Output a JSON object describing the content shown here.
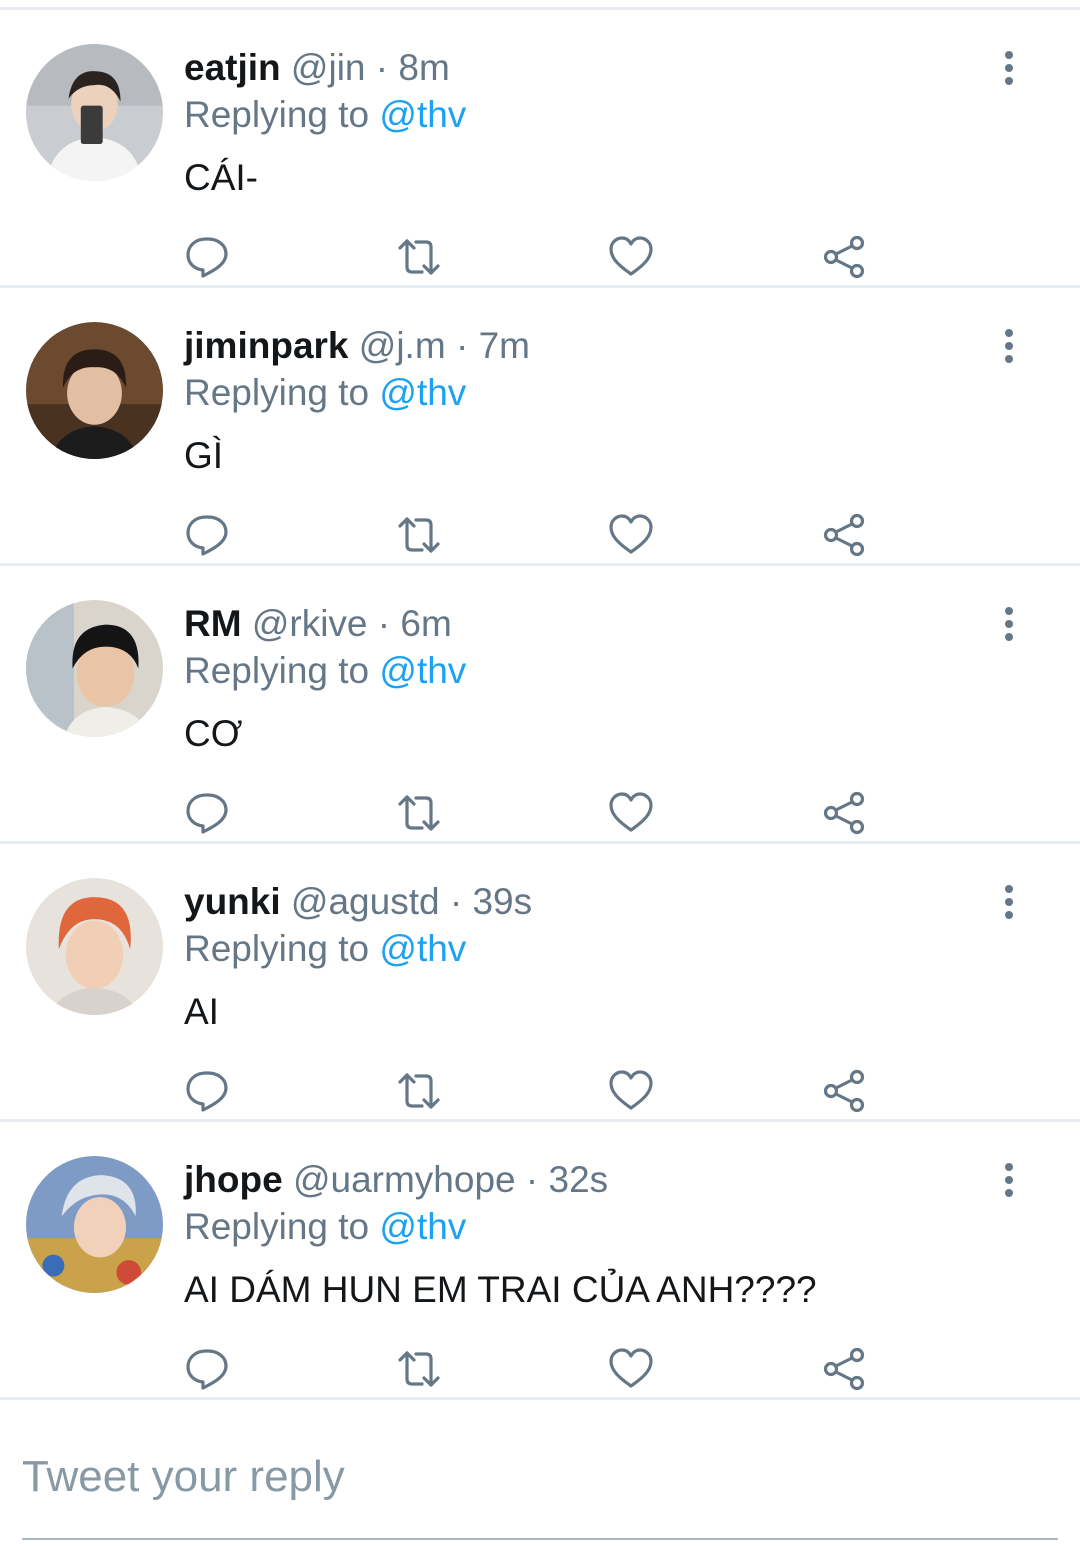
{
  "replying_prefix": "Replying to",
  "tweets": [
    {
      "name": "eatjin",
      "handle": "@jin",
      "separator": "·",
      "time": "8m",
      "reply_to": "@thv",
      "text": "CÁI-"
    },
    {
      "name": "jiminpark",
      "handle": "@j.m",
      "separator": "·",
      "time": "7m",
      "reply_to": "@thv",
      "text": "GÌ"
    },
    {
      "name": "RM",
      "handle": "@rkive",
      "separator": "·",
      "time": "6m",
      "reply_to": "@thv",
      "text": "CƠ"
    },
    {
      "name": "yunki",
      "handle": "@agustd",
      "separator": "·",
      "time": "39s",
      "reply_to": "@thv",
      "text": "AI"
    },
    {
      "name": "jhope",
      "handle": "@uarmyhope",
      "separator": "·",
      "time": "32s",
      "reply_to": "@thv",
      "text": "AI DÁM HUN EM TRAI CỦA ANH????"
    }
  ],
  "compose": {
    "placeholder": "Tweet your reply"
  },
  "icons": {
    "reply": "reply-icon",
    "retweet": "retweet-icon",
    "like": "heart-icon",
    "share": "share-icon",
    "more": "more-vertical-icon"
  },
  "colors": {
    "accent": "#1da1f2",
    "text_primary": "#14171a",
    "text_secondary": "#657786",
    "divider": "#e6ecf0"
  }
}
